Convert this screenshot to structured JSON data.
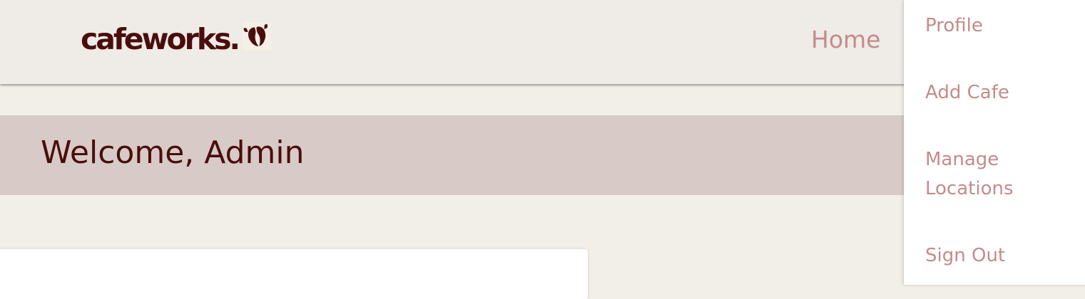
{
  "brand": {
    "name": "cafeworks.",
    "icon": "coffee-bean-icon"
  },
  "nav": {
    "home_label": "Home"
  },
  "welcome": {
    "title": "Welcome, Admin"
  },
  "dropdown": {
    "items": [
      {
        "label": "Profile"
      },
      {
        "label": "Add Cafe"
      },
      {
        "label": "Manage Locations"
      },
      {
        "label": "Sign Out"
      }
    ]
  },
  "colors": {
    "brand_dark": "#4a0d0d",
    "link_rose": "#c48b8b",
    "navbar_bg": "#efebe7",
    "banner_bg": "#d8cbc7",
    "page_bg": "#f2eee8"
  }
}
